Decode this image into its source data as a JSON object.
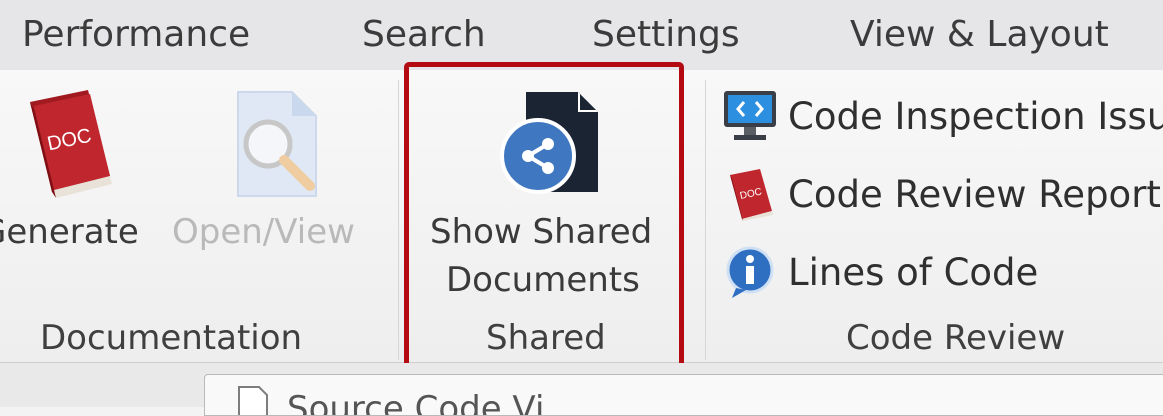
{
  "menu": {
    "items": [
      "Performance",
      "Search",
      "Settings",
      "View & Layout"
    ]
  },
  "ribbon": {
    "documentation": {
      "group_label": "Documentation",
      "generate_label": "Generate",
      "open_view_label": "Open/View"
    },
    "shared": {
      "group_label": "Shared",
      "show_shared_line1": "Show Shared",
      "show_shared_line2": "Documents"
    },
    "code_review": {
      "group_label": "Code Review",
      "items": [
        "Code Inspection Issu",
        "Code Review Report",
        "Lines of Code"
      ]
    }
  },
  "doc_icon_text": "DOC",
  "tab_partial": "Source Code Vi",
  "colors": {
    "highlight": "#b40a12",
    "doc_red": "#c0262d",
    "shared_blue": "#3f78c1",
    "dark_navy": "#1b2433"
  }
}
